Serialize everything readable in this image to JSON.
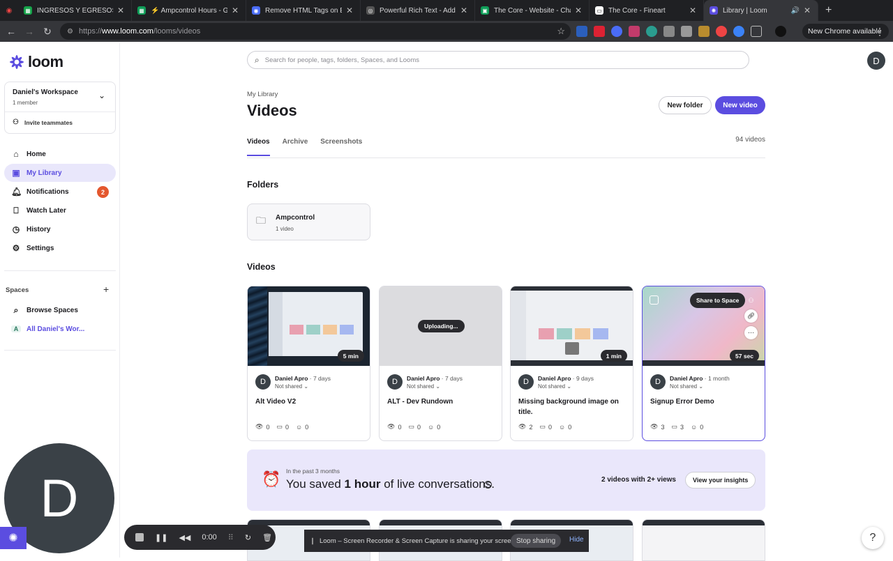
{
  "browser": {
    "tabs": [
      {
        "title": "INGRESOS Y EGRESOS CAS",
        "color": "#16a34a",
        "glyph": "▦"
      },
      {
        "title": "⚡ Ampcontrol Hours - Goo",
        "color": "#0f9d58",
        "glyph": "▦"
      },
      {
        "title": "Remove HTML Tags on Emp",
        "color": "#4a6cf7",
        "glyph": "◉"
      },
      {
        "title": "Powerful Rich Text - Add HT",
        "color": "#555555",
        "glyph": "◎"
      },
      {
        "title": "The Core - Website - Chat",
        "color": "#0f9d58",
        "glyph": "▣"
      },
      {
        "title": "The Core - Fineart",
        "color": "#ffffff",
        "glyph": "▭"
      },
      {
        "title": "Library | Loom",
        "color": "#5b4de0",
        "glyph": "✺"
      }
    ],
    "url_prefix": "https://",
    "url_host": "www.loom.com",
    "url_path": "/looms/videos",
    "update_label": "New Chrome available"
  },
  "sidebar": {
    "brand": "loom",
    "workspace_name": "Daniel's Workspace",
    "workspace_members": "1 member",
    "invite_label": "Invite teammates",
    "nav": [
      {
        "label": "Home",
        "icon": "home-icon"
      },
      {
        "label": "My Library",
        "icon": "library-icon"
      },
      {
        "label": "Notifications",
        "icon": "bell-icon",
        "badge": "2"
      },
      {
        "label": "Watch Later",
        "icon": "bookmark-icon"
      },
      {
        "label": "History",
        "icon": "clock-icon"
      },
      {
        "label": "Settings",
        "icon": "gear-icon"
      }
    ],
    "spaces_header": "Spaces",
    "spaces": [
      {
        "label": "Browse Spaces",
        "icon": "search-icon"
      },
      {
        "label": "All Daniel's Wor...",
        "icon": "A"
      }
    ]
  },
  "header": {
    "search_placeholder": "Search for people, tags, folders, Spaces, and Looms",
    "avatar_letter": "D",
    "breadcrumb": "My Library",
    "title": "Videos",
    "new_folder_label": "New folder",
    "new_video_label": "New video",
    "tabs": [
      "Videos",
      "Archive",
      "Screenshots"
    ],
    "video_count": "94 videos"
  },
  "folders": {
    "heading": "Folders",
    "items": [
      {
        "name": "Ampcontrol",
        "count": "1 video"
      }
    ]
  },
  "videos": {
    "heading": "Videos",
    "items": [
      {
        "title": "Alt Video V2",
        "owner": "Daniel Apro",
        "age": "· 7 days",
        "sharing": "Not shared",
        "duration": "5 min",
        "views": "0",
        "comments": "0",
        "reactions": "0"
      },
      {
        "title": "ALT - Dev Rundown",
        "owner": "Daniel Apro",
        "age": "· 7 days",
        "sharing": "Not shared",
        "status": "Uploading...",
        "views": "0",
        "comments": "0",
        "reactions": "0"
      },
      {
        "title": "Missing background image on title.",
        "owner": "Daniel Apro",
        "age": "· 9 days",
        "sharing": "Not shared",
        "duration": "1 min",
        "views": "2",
        "comments": "0",
        "reactions": "0"
      },
      {
        "title": "Signup Error Demo",
        "owner": "Daniel Apro",
        "age": "· 1 month",
        "sharing": "Not shared",
        "duration": "57 sec",
        "views": "3",
        "comments": "3",
        "reactions": "0",
        "hover_action": "Share to Space"
      }
    ]
  },
  "insights": {
    "period": "In the past 3 months",
    "saved_prefix": "You saved",
    "saved_value": "1 hour",
    "saved_suffix": "of live conversations.",
    "summary": "2 videos with 2+ views",
    "cta": "View your insights"
  },
  "recorder": {
    "avatar_letter": "D",
    "timer": "0:00",
    "share_notice": "Loom – Screen Recorder & Screen Capture is sharing your screen.",
    "stop_label": "Stop sharing",
    "hide_label": "Hide"
  },
  "colors": {
    "accent": "#5b4de0",
    "badge": "#e4572e",
    "insights_bg": "#eae7fb"
  }
}
